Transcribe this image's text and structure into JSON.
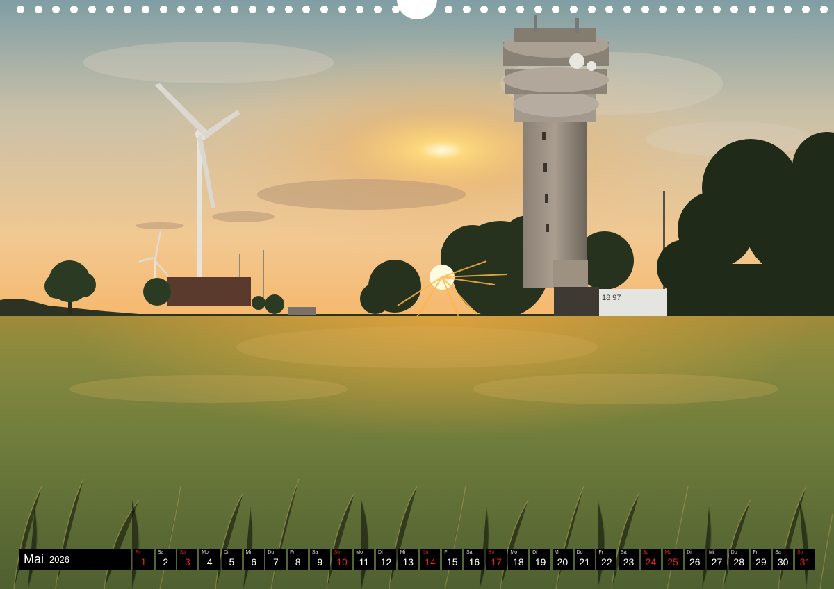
{
  "calendar": {
    "month": "Mai",
    "year": "2026",
    "days": [
      {
        "weekday": "Fr",
        "day": "1",
        "holiday": true
      },
      {
        "weekday": "Sa",
        "day": "2",
        "holiday": false
      },
      {
        "weekday": "So",
        "day": "3",
        "holiday": true
      },
      {
        "weekday": "Mo",
        "day": "4",
        "holiday": false
      },
      {
        "weekday": "Di",
        "day": "5",
        "holiday": false
      },
      {
        "weekday": "Mi",
        "day": "6",
        "holiday": false
      },
      {
        "weekday": "Do",
        "day": "7",
        "holiday": false
      },
      {
        "weekday": "Fr",
        "day": "8",
        "holiday": false
      },
      {
        "weekday": "Sa",
        "day": "9",
        "holiday": false
      },
      {
        "weekday": "So",
        "day": "10",
        "holiday": true
      },
      {
        "weekday": "Mo",
        "day": "11",
        "holiday": false
      },
      {
        "weekday": "Di",
        "day": "12",
        "holiday": false
      },
      {
        "weekday": "Mi",
        "day": "13",
        "holiday": false
      },
      {
        "weekday": "Do",
        "day": "14",
        "holiday": true
      },
      {
        "weekday": "Fr",
        "day": "15",
        "holiday": false
      },
      {
        "weekday": "Sa",
        "day": "16",
        "holiday": false
      },
      {
        "weekday": "So",
        "day": "17",
        "holiday": true
      },
      {
        "weekday": "Mo",
        "day": "18",
        "holiday": false
      },
      {
        "weekday": "Di",
        "day": "19",
        "holiday": false
      },
      {
        "weekday": "Mi",
        "day": "20",
        "holiday": false
      },
      {
        "weekday": "Do",
        "day": "21",
        "holiday": false
      },
      {
        "weekday": "Fr",
        "day": "22",
        "holiday": false
      },
      {
        "weekday": "Sa",
        "day": "23",
        "holiday": false
      },
      {
        "weekday": "So",
        "day": "24",
        "holiday": true
      },
      {
        "weekday": "Mo",
        "day": "25",
        "holiday": true
      },
      {
        "weekday": "Di",
        "day": "26",
        "holiday": false
      },
      {
        "weekday": "Mi",
        "day": "27",
        "holiday": false
      },
      {
        "weekday": "Do",
        "day": "28",
        "holiday": false
      },
      {
        "weekday": "Fr",
        "day": "29",
        "holiday": false
      },
      {
        "weekday": "Sa",
        "day": "30",
        "holiday": false
      },
      {
        "weekday": "So",
        "day": "31",
        "holiday": true
      }
    ]
  },
  "photo": {
    "building_sign": "18 97"
  },
  "colors": {
    "holiday": "#e0231c",
    "strip_background": "#000000",
    "sky_top": "#8aa3a6",
    "sky_horizon": "#f4c58a",
    "sun": "#fff2b8",
    "field": "#6f7d3c"
  }
}
